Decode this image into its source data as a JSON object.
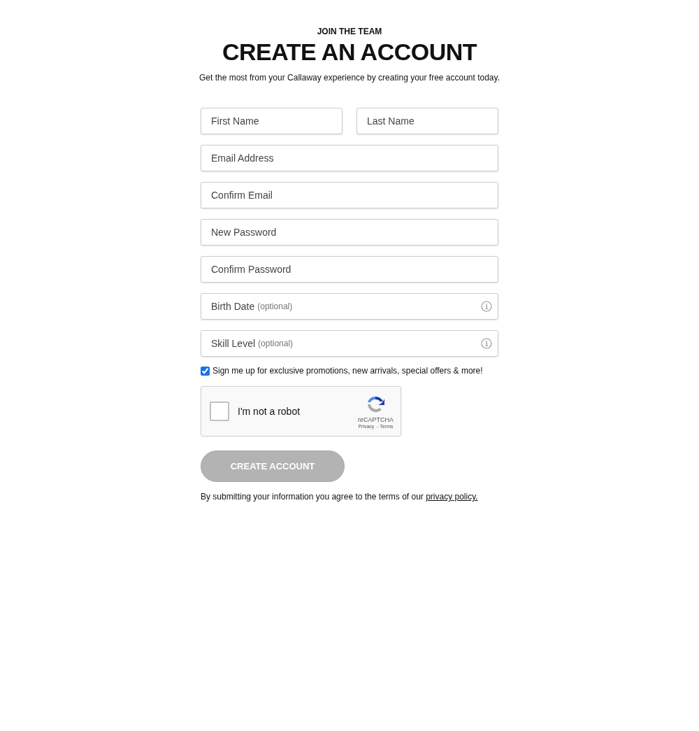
{
  "eyebrow": "JOIN THE TEAM",
  "title": "CREATE AN ACCOUNT",
  "subtitle": "Get the most from your Callaway experience by creating your free account today.",
  "name_fields": [
    {
      "placeholder": "First Name"
    },
    {
      "placeholder": "Last Name"
    }
  ],
  "fields": [
    {
      "kind": "text",
      "placeholder": "Email Address"
    },
    {
      "kind": "text",
      "placeholder": "Confirm Email"
    },
    {
      "kind": "text",
      "placeholder": "New Password"
    },
    {
      "kind": "text",
      "placeholder": "Confirm Password"
    },
    {
      "kind": "optional",
      "placeholder": "Birth Date",
      "hint": "(optional)"
    },
    {
      "kind": "optional",
      "placeholder": "Skill Level",
      "hint": "(optional)"
    }
  ],
  "newsletter": {
    "label": "Sign me up for exclusive promotions, new arrivals, special offers & more!",
    "checked": true
  },
  "captcha": {
    "label": "I'm not a robot",
    "checked": false,
    "brand": "reCAPTCHA",
    "privacy": "Privacy",
    "terms": "- Terms"
  },
  "submit": {
    "label": "CREATE ACCOUNT",
    "disabled": true
  },
  "legal": {
    "text": "By submitting your information you agree to the terms of our",
    "link": "privacy policy."
  }
}
